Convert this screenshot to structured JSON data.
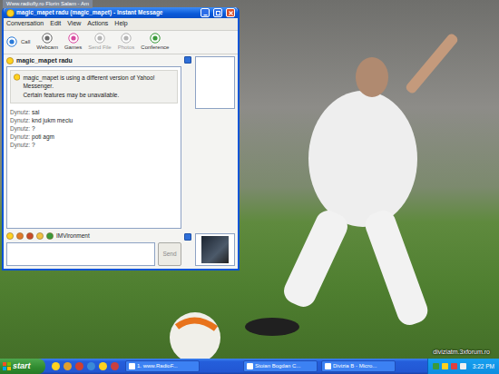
{
  "top_strip": {
    "title": "Www.radiofly.ro Florin Salam - Am"
  },
  "window": {
    "title": "magic_mapet radu (magic_mapet) - Instant Message"
  },
  "menu": [
    "Conversation",
    "Edit",
    "View",
    "Actions",
    "Help"
  ],
  "toolbar": [
    {
      "label": "Call",
      "disabled": false
    },
    {
      "label": "Webcam",
      "disabled": false
    },
    {
      "label": "Games",
      "disabled": false
    },
    {
      "label": "Send File",
      "disabled": true
    },
    {
      "label": "Photos",
      "disabled": true
    },
    {
      "label": "Conference",
      "disabled": false
    }
  ],
  "contact": {
    "name": "magic_mapet radu"
  },
  "notice": {
    "lines": [
      "magic_mapet is using a different version of Yahoo! Messenger.",
      "Certain features may be unavailable."
    ]
  },
  "messages": [
    {
      "sender": "Dynutz:",
      "text": "sal"
    },
    {
      "sender": "Dynutz:",
      "text": "knd jukm meciu"
    },
    {
      "sender": "Dynutz:",
      "text": "?"
    },
    {
      "sender": "Dynutz:",
      "text": "poti agm"
    },
    {
      "sender": "Dynutz:",
      "text": "?"
    }
  ],
  "format_bar": {
    "label": "IMVironment"
  },
  "send": {
    "label": "Send",
    "disabled": true
  },
  "taskbar": {
    "start": "start",
    "tasks": [
      {
        "label": "1. www.RadioF...",
        "selected": false
      },
      {
        "label": "Stoian Bogdan C...",
        "selected": false
      },
      {
        "label": "Divizia B - Micro...",
        "selected": false
      }
    ],
    "clock": "3:22 PM"
  },
  "watermark": "diviziatm.3xforum.ro"
}
